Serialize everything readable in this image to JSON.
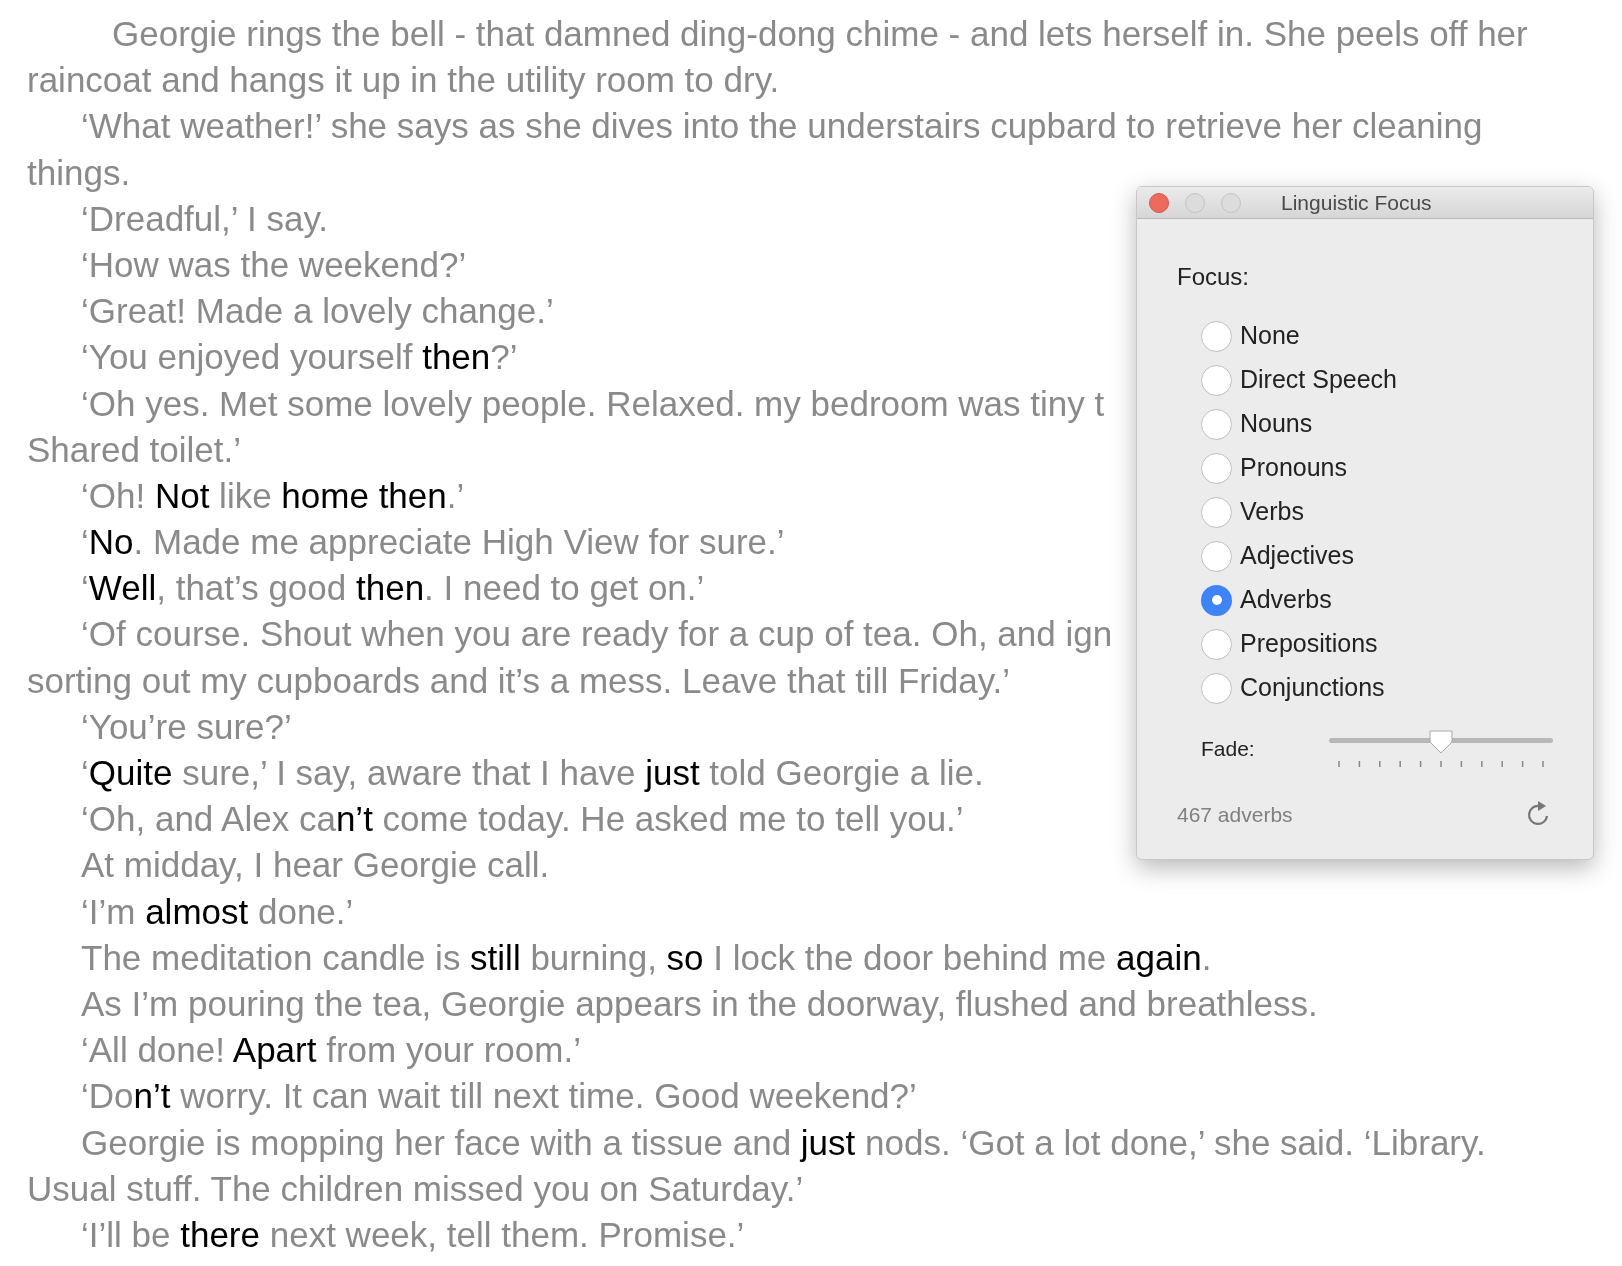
{
  "document": {
    "lines": [
      {
        "kind": "first",
        "segments": [
          {
            "text": "Georgie rings the bell - that damned ding-dong chime - and lets herself in. She peels off her",
            "highlight": false
          }
        ]
      },
      {
        "kind": "continuation",
        "segments": [
          {
            "text": "raincoat and hangs it up in the utility room to dry.",
            "highlight": false
          }
        ]
      },
      {
        "kind": "indent",
        "segments": [
          {
            "text": "‘What weather!’ she says as she dives into the understairs cupbard to retrieve her cleaning",
            "highlight": false
          }
        ]
      },
      {
        "kind": "continuation",
        "segments": [
          {
            "text": "things.",
            "highlight": false
          }
        ]
      },
      {
        "kind": "indent",
        "segments": [
          {
            "text": "‘Dreadful,’ I say.",
            "highlight": false
          }
        ]
      },
      {
        "kind": "indent",
        "segments": [
          {
            "text": "‘How was the weekend?’",
            "highlight": false
          }
        ]
      },
      {
        "kind": "indent",
        "segments": [
          {
            "text": "‘Great! Made a lovely change.’",
            "highlight": false
          }
        ]
      },
      {
        "kind": "indent",
        "segments": [
          {
            "text": "‘You enjoyed yourself ",
            "highlight": false
          },
          {
            "text": "then",
            "highlight": true
          },
          {
            "text": "?’",
            "highlight": false
          }
        ]
      },
      {
        "kind": "indent",
        "segments": [
          {
            "text": "‘Oh yes. Met some lovely people. Relaxed. my bedroom was tiny t",
            "highlight": false
          }
        ]
      },
      {
        "kind": "continuation",
        "segments": [
          {
            "text": "Shared toilet.’",
            "highlight": false
          }
        ]
      },
      {
        "kind": "indent",
        "segments": [
          {
            "text": "‘Oh! ",
            "highlight": false
          },
          {
            "text": "Not",
            "highlight": true
          },
          {
            "text": " like ",
            "highlight": false
          },
          {
            "text": "home then",
            "highlight": true
          },
          {
            "text": ".’",
            "highlight": false
          }
        ]
      },
      {
        "kind": "indent",
        "segments": [
          {
            "text": "‘",
            "highlight": false
          },
          {
            "text": "No",
            "highlight": true
          },
          {
            "text": ". Made me appreciate High View for sure.’",
            "highlight": false
          }
        ]
      },
      {
        "kind": "indent",
        "segments": [
          {
            "text": "‘",
            "highlight": false
          },
          {
            "text": "Well",
            "highlight": true
          },
          {
            "text": ", that’s good ",
            "highlight": false
          },
          {
            "text": "then",
            "highlight": true
          },
          {
            "text": ". I need to get on.’",
            "highlight": false
          }
        ]
      },
      {
        "kind": "indent",
        "segments": [
          {
            "text": "‘Of course. Shout when you are ready for a cup of tea. Oh, and ign",
            "highlight": false
          }
        ]
      },
      {
        "kind": "continuation",
        "segments": [
          {
            "text": "sorting out my cupboards and it’s a mess. Leave that till Friday.’",
            "highlight": false
          }
        ]
      },
      {
        "kind": "indent",
        "segments": [
          {
            "text": "‘You’re sure?’",
            "highlight": false
          }
        ]
      },
      {
        "kind": "indent",
        "segments": [
          {
            "text": "‘",
            "highlight": false
          },
          {
            "text": "Quite",
            "highlight": true
          },
          {
            "text": " sure,’ I say, aware that I have ",
            "highlight": false
          },
          {
            "text": "just",
            "highlight": true
          },
          {
            "text": " told Georgie a lie.",
            "highlight": false
          }
        ]
      },
      {
        "kind": "indent",
        "segments": [
          {
            "text": "‘Oh, and Alex ca",
            "highlight": false
          },
          {
            "text": "n’t",
            "highlight": true
          },
          {
            "text": " come today. He asked me to tell you.’",
            "highlight": false
          }
        ]
      },
      {
        "kind": "indent",
        "segments": [
          {
            "text": "At midday, I hear Georgie call.",
            "highlight": false
          }
        ]
      },
      {
        "kind": "indent",
        "segments": [
          {
            "text": "‘I’m ",
            "highlight": false
          },
          {
            "text": "almost",
            "highlight": true
          },
          {
            "text": " done.’",
            "highlight": false
          }
        ]
      },
      {
        "kind": "indent",
        "segments": [
          {
            "text": "The meditation candle is ",
            "highlight": false
          },
          {
            "text": "still",
            "highlight": true
          },
          {
            "text": " burning, ",
            "highlight": false
          },
          {
            "text": "so",
            "highlight": true
          },
          {
            "text": " I lock the door behind me ",
            "highlight": false
          },
          {
            "text": "again",
            "highlight": true
          },
          {
            "text": ".",
            "highlight": false
          }
        ]
      },
      {
        "kind": "indent",
        "segments": [
          {
            "text": "As I’m pouring the tea, Georgie appears in the doorway, flushed and breathless.",
            "highlight": false
          }
        ]
      },
      {
        "kind": "indent",
        "segments": [
          {
            "text": "‘All done! ",
            "highlight": false
          },
          {
            "text": "Apart",
            "highlight": true
          },
          {
            "text": " from your room.’",
            "highlight": false
          }
        ]
      },
      {
        "kind": "indent",
        "segments": [
          {
            "text": "‘Do",
            "highlight": false
          },
          {
            "text": "n’t",
            "highlight": true
          },
          {
            "text": " worry. It can wait till next time. Good weekend?’",
            "highlight": false
          }
        ]
      },
      {
        "kind": "indent",
        "segments": [
          {
            "text": "Georgie is mopping her face with a tissue and ",
            "highlight": false
          },
          {
            "text": "just",
            "highlight": true
          },
          {
            "text": " nods. ‘Got a lot done,’ she said. ‘Library.",
            "highlight": false
          }
        ]
      },
      {
        "kind": "continuation",
        "segments": [
          {
            "text": "Usual stuff. The children missed you on Saturday.’",
            "highlight": false
          }
        ]
      },
      {
        "kind": "indent",
        "segments": [
          {
            "text": "‘I’ll be ",
            "highlight": false
          },
          {
            "text": "there",
            "highlight": true
          },
          {
            "text": " next week, tell them. Promise.’",
            "highlight": false
          }
        ]
      }
    ]
  },
  "panel": {
    "title": "Linguistic Focus",
    "focus_label": "Focus:",
    "options": [
      {
        "label": "None",
        "selected": false
      },
      {
        "label": "Direct Speech",
        "selected": false
      },
      {
        "label": "Nouns",
        "selected": false
      },
      {
        "label": "Pronouns",
        "selected": false
      },
      {
        "label": "Verbs",
        "selected": false
      },
      {
        "label": "Adjectives",
        "selected": false
      },
      {
        "label": "Adverbs",
        "selected": true
      },
      {
        "label": "Prepositions",
        "selected": false
      },
      {
        "label": "Conjunctions",
        "selected": false
      }
    ],
    "fade": {
      "label": "Fade:",
      "level": 0.5
    },
    "count": "467 adverbs"
  }
}
